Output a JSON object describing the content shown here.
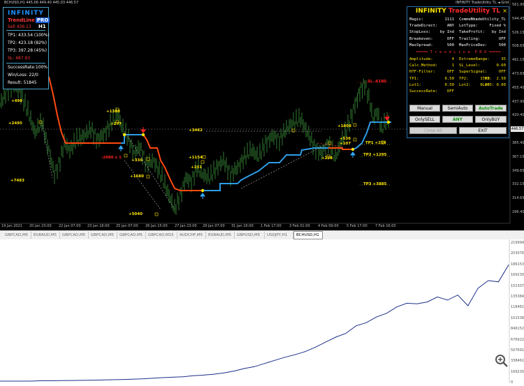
{
  "window": {
    "title_left": "BCHUSD,H1  445.06 449.40 445.03 446.57",
    "title_right": "INFINITY TradeUtility TL ◄ Grid"
  },
  "price_axis": {
    "labels": [
      "561.90",
      "544.45",
      "526.15",
      "508.65",
      "491.15",
      "473.65",
      "455.40",
      "437.90",
      "420.40",
      "402.90",
      "385.40",
      "367.15",
      "349.65",
      "332.15",
      "314.65",
      "296.40"
    ],
    "current_price": "446.57"
  },
  "time_axis": {
    "labels": [
      "19 Jan 2021",
      "20 Jan 23:00",
      "22 Jan 07:00",
      "23 Jan 16:00",
      "25 Jan 07:00",
      "26 Jan 15:00",
      "27 Jan 23:00",
      "29 Jan 07:00",
      "31 Jan 16:00",
      "1 Feb 17:00",
      "3 Feb 01:00",
      "4 Feb 09:00",
      "5 Feb 17:00",
      "7 Feb 16:00"
    ]
  },
  "info_box": {
    "title": "INFINITY",
    "trendline": "TrendLine",
    "pro": "PRO",
    "sell": "Sell 436.13",
    "timeframe": "H1",
    "tp1": "TP1: 433.54 (100%)",
    "tp2": "TP2: 423.18 (82%)",
    "tp3": "TP3: 397.28 (45%)",
    "sl": "SL: 487.93",
    "success_rate": "SuccessRate:100%",
    "winloss": "Win/Loss: 22/0",
    "result": "Result: 51845"
  },
  "chart_labels": {
    "p498": "+498",
    "p2495": "+2495",
    "p7483": "+7483",
    "p1388": "+1388",
    "p277": "+277",
    "m2080": "-2080 x 1",
    "p336": "+336",
    "p1680": "+1680",
    "p5040": "+5040",
    "p3462": "+3462",
    "p1154": "+1154",
    "p231": "+231",
    "p1808": "+1808",
    "p536": "+536",
    "p107": "+107",
    "p228": "+228",
    "sl6180": "SL -6180",
    "tp1": "TP1 +259",
    "tp2": "TP2 +1295",
    "tp3": "TP3 +3885"
  },
  "panel": {
    "title_a": "INFINITY",
    "title_b": "TradeUtility TL",
    "close": "×",
    "rows": [
      {
        "a": "Magic:",
        "av": "1111",
        "b": "Comment:",
        "bv": "TradeUtility_TL"
      },
      {
        "a": "TradeDirect:",
        "av": "ANY",
        "b": "LotType:",
        "bv": "Fixed %"
      },
      {
        "a": "StopLoss:",
        "av": "by Ind",
        "b": "TakeProfit:",
        "bv": "by Ind"
      },
      {
        "a": "Breakeven:",
        "av": "OFF",
        "b": "Trailing:",
        "bv": "OFF"
      },
      {
        "a": "MaxSpread:",
        "av": "500",
        "b": "MaxPriceDev:",
        "bv": "500"
      }
    ],
    "separator": "===== T r e n d L i n e  P R O =====",
    "rows2": [
      {
        "a": "Amplitude:",
        "av": "4",
        "b": "ExtremeRange:",
        "bv": "35"
      },
      {
        "a": "Calc.Method:",
        "av": "1",
        "b": "SL_Level:",
        "bv": "0.60"
      },
      {
        "a": "HTF-Filter:",
        "av": "OFF",
        "b": "SuperSignal:",
        "bv": "OFF"
      },
      {
        "a": "TP1:",
        "av": "0.50",
        "b": "TP2:     1.00",
        "bv": "TP3:  2.50"
      },
      {
        "a": "Lot1:",
        "av": "0.50",
        "b": "Lot2:    0.00",
        "bv": "Lot3: 0.00"
      },
      {
        "a": "SuccessRate:",
        "av": "OFF",
        "b": "",
        "bv": ""
      }
    ],
    "buttons": {
      "manual": "Manual",
      "semiauto": "SemiAuto",
      "autotrade": "AutoTrade",
      "onlysell": "OnlySELL",
      "any": "ANY",
      "onlybuy": "OnlyBUY",
      "closeall": "Close All",
      "exit": "EXIT"
    }
  },
  "tabs": [
    "GBPCAD,M5",
    "EURAUD,M5",
    "GBPCAD,M5",
    "GBPCAD,M5",
    "GBPCAD,M5",
    "GBPCAD,M15",
    "AUDCHF,M5",
    "EURAUD,M5",
    "GBPUSD,M5",
    "USDJPY,H1",
    "BCHUSD,H1"
  ],
  "balance_axis": [
    "2199990",
    "2030760",
    "1861538",
    "1692304",
    "1523074",
    "1353843",
    "1184613",
    "1015383",
    "846152",
    "676922",
    "507691",
    "338461",
    "169230",
    "0"
  ],
  "colors": {
    "up_line": "#2e9de6",
    "down_line": "#ff4a10",
    "balance_line": "#1c2f8a",
    "candles": "#2f7a2f"
  },
  "chart_data": {
    "type": "line",
    "title": "",
    "xlabel": "",
    "ylabel": "",
    "x": [
      0,
      2,
      4,
      6,
      8,
      10,
      12,
      14,
      16,
      18,
      20,
      22,
      24,
      26,
      28,
      30,
      32,
      34,
      36,
      38,
      40,
      42,
      44,
      46,
      48,
      50,
      52,
      54,
      56,
      58,
      60,
      62,
      64,
      66,
      68,
      70,
      72,
      74,
      76,
      78,
      80,
      82,
      84,
      86,
      88,
      90,
      92,
      94,
      96,
      98,
      100
    ],
    "series": [
      {
        "values": [
          0,
          0,
          0,
          0,
          5000,
          6000,
          9000,
          10000,
          12000,
          14000,
          18000,
          22000,
          26000,
          30000,
          36000,
          45000,
          55000,
          62000,
          70000,
          85000,
          95000,
          110000,
          130000,
          160000,
          200000,
          230000,
          280000,
          330000,
          380000,
          420000,
          470000,
          540000,
          620000,
          700000,
          760000,
          880000,
          930000,
          1020000,
          1080000,
          1180000,
          1240000,
          1230000,
          1260000,
          1340000,
          1290000,
          1370000,
          1200000,
          1480000,
          1600000,
          1580000,
          1850000
        ]
      }
    ],
    "ylim": [
      0,
      2199990
    ],
    "grid": false
  }
}
